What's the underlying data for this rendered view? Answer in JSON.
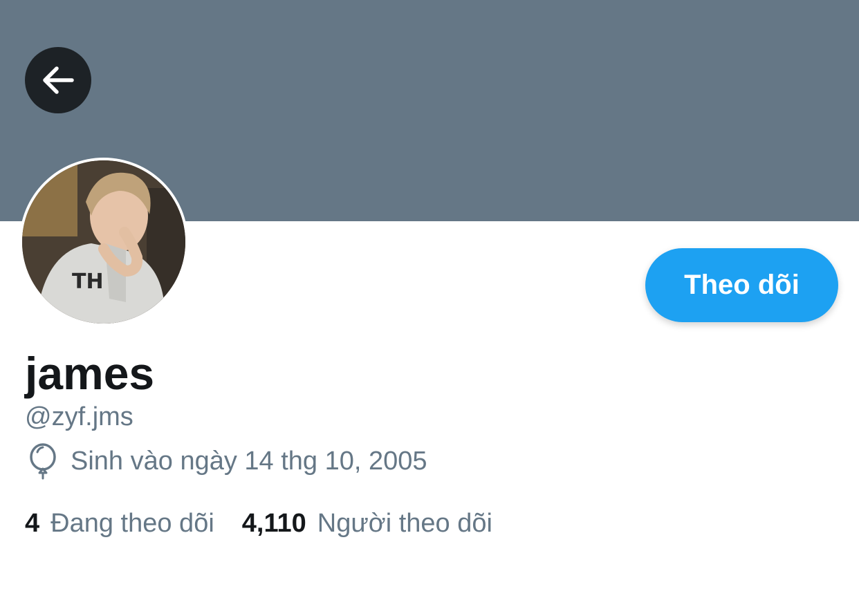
{
  "header": {
    "back_icon": "arrow-left-icon",
    "banner_color": "#657786"
  },
  "profile": {
    "display_name": "james",
    "handle": "@zyf.jms",
    "birth_icon": "balloon-icon",
    "birth_text": "Sinh vào ngày 14 thg 10, 2005",
    "follow_label": "Theo dõi",
    "accent_color": "#1da1f2"
  },
  "stats": {
    "following_count": "4",
    "following_label": "Đang theo dõi",
    "followers_count": "4,110",
    "followers_label": "Người theo dõi"
  }
}
